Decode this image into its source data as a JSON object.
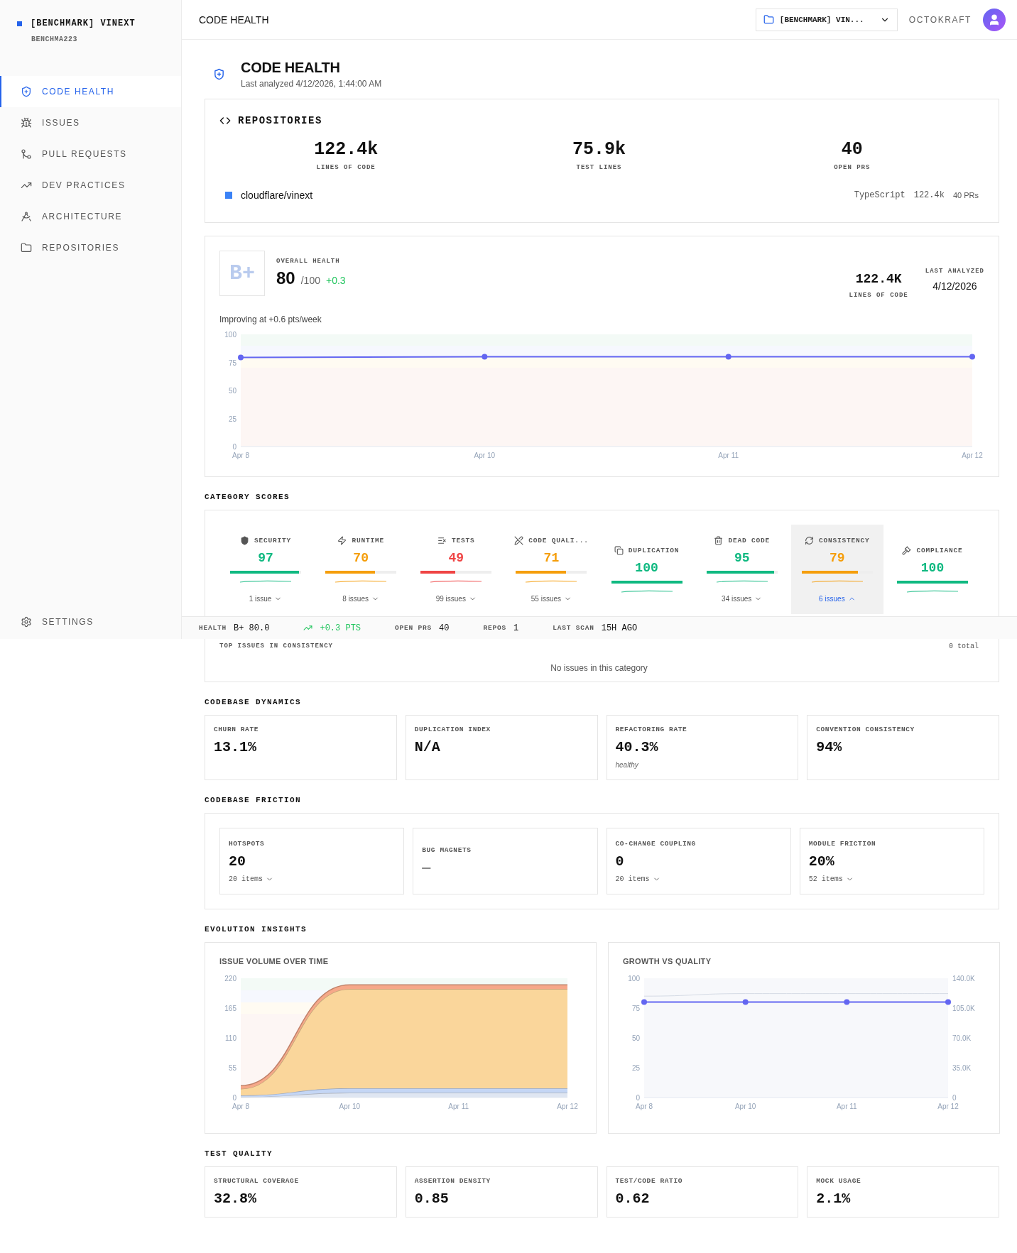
{
  "sidebar": {
    "workspace": "[BENCHMARK] VINEXT",
    "subtitle": "BENCHMA223",
    "items": [
      {
        "kind": "health",
        "label": "CODE HEALTH",
        "selected": true
      },
      {
        "kind": "issues",
        "label": "ISSUES",
        "selected": false
      },
      {
        "kind": "pulls",
        "label": "PULL REQUESTS",
        "selected": false
      },
      {
        "kind": "practices",
        "label": "DEV PRACTICES",
        "selected": false
      },
      {
        "kind": "architecture",
        "label": "ARCHITECTURE",
        "selected": false
      },
      {
        "kind": "repositories",
        "label": "REPOSITORIES",
        "selected": false
      }
    ],
    "settings": "SETTINGS"
  },
  "header": {
    "title": "CODE HEALTH",
    "repo_selector": "[BENCHMARK] VIN...",
    "org": "OCTOKRAFT"
  },
  "page": {
    "title": "CODE HEALTH",
    "subtitle": "Last analyzed 4/12/2026, 1:44:00 AM"
  },
  "repositories": {
    "title": "REPOSITORIES",
    "stats": [
      {
        "value": "122.4k",
        "label": "LINES OF CODE"
      },
      {
        "value": "75.9k",
        "label": "TEST LINES"
      },
      {
        "value": "40",
        "label": "OPEN PRS"
      }
    ],
    "repos": [
      {
        "name": "cloudflare/vinext",
        "color": "#3b82f6",
        "language": "TypeScript",
        "loc": "122.4k",
        "prs": "40 PRs"
      }
    ]
  },
  "health": {
    "grade": "B+",
    "label": "OVERALL HEALTH",
    "score": "80",
    "max": "/100",
    "delta": "+0.3",
    "loc_value": "122.4K",
    "loc_label": "LINES OF CODE",
    "analyzed_label": "LAST ANALYZED",
    "analyzed_value": "4/12/2026",
    "trend": "Improving at +0.6 pts/week",
    "chart_data": {
      "type": "line",
      "categories": [
        "Apr 8",
        "Apr 10",
        "Apr 11",
        "Apr 12"
      ],
      "series": [
        {
          "color": "#6366f1",
          "marker": "o",
          "values": [
            79.5,
            80,
            80,
            80
          ]
        }
      ],
      "ylim": [
        0,
        100
      ],
      "yticks": [
        0,
        25,
        50,
        75,
        100
      ]
    }
  },
  "category_scores": {
    "title": "CATEGORY SCORES",
    "items": [
      {
        "kind": "security",
        "name": "SECURITY",
        "score": "97",
        "level": 0.97,
        "color": "#10b981",
        "issues": "1 issue",
        "selected": false
      },
      {
        "kind": "runtime",
        "name": "RUNTIME",
        "score": "70",
        "level": 0.7,
        "color": "#f59e0b",
        "issues": "8 issues",
        "selected": false
      },
      {
        "kind": "tests",
        "name": "TESTS",
        "score": "49",
        "level": 0.49,
        "color": "#ef4444",
        "issues": "99 issues",
        "selected": false
      },
      {
        "kind": "quality",
        "name": "CODE QUALI...",
        "score": "71",
        "level": 0.71,
        "color": "#f59e0b",
        "issues": "55 issues",
        "selected": false
      },
      {
        "kind": "duplication",
        "name": "DUPLICATION",
        "score": "100",
        "level": 1,
        "color": "#10b981",
        "selected": false
      },
      {
        "kind": "dead",
        "name": "DEAD CODE",
        "score": "95",
        "level": 0.95,
        "color": "#10b981",
        "issues": "34 issues",
        "selected": false
      },
      {
        "kind": "consistency",
        "name": "CONSISTENCY",
        "score": "79",
        "level": 0.79,
        "color": "#f59e0b",
        "issues": "6 issues",
        "selected": true
      },
      {
        "kind": "compliance",
        "name": "COMPLIANCE",
        "score": "100",
        "level": 1,
        "color": "#10b981",
        "selected": false
      }
    ],
    "detail": {
      "title": "TOP ISSUES IN CONSISTENCY",
      "count": "0 total",
      "empty": "No issues in this category"
    }
  },
  "status_bar": [
    {
      "kind": "stat",
      "label": "HEALTH",
      "value": "B+ 80.0"
    },
    {
      "kind": "trend",
      "value": "+0.3 PTS"
    },
    {
      "kind": "stat",
      "label": "OPEN PRS",
      "value": "40"
    },
    {
      "kind": "stat",
      "label": "REPOS",
      "value": "1"
    },
    {
      "kind": "stat",
      "label": "LAST SCAN",
      "value": "15H AGO"
    }
  ],
  "dynamics": {
    "title": "CODEBASE DYNAMICS",
    "cards": [
      {
        "label": "CHURN RATE",
        "value": "13.1%"
      },
      {
        "label": "DUPLICATION INDEX",
        "value": "N/A"
      },
      {
        "label": "REFACTORING RATE",
        "value": "40.3%",
        "note": "healthy"
      },
      {
        "label": "CONVENTION CONSISTENCY",
        "value": "94%"
      }
    ]
  },
  "friction": {
    "title": "CODEBASE FRICTION",
    "cards": [
      {
        "label": "HOTSPOTS",
        "value": "20",
        "items": "20 items"
      },
      {
        "label": "BUG MAGNETS",
        "value": "—",
        "disabled": true
      },
      {
        "label": "CO-CHANGE COUPLING",
        "value": "0",
        "items": "20 items"
      },
      {
        "label": "MODULE FRICTION",
        "value": "20%",
        "items": "52 items"
      }
    ]
  },
  "evolution": {
    "title": "EVOLUTION INSIGHTS",
    "charts": [
      {
        "title": "ISSUE VOLUME OVER TIME",
        "chart_data": {
          "type": "area",
          "stacked": true,
          "categories": [
            "Apr 8",
            "Apr 10",
            "Apr 11",
            "Apr 12"
          ],
          "series": [
            {
              "color": "#dfe6f2",
              "values": [
                1,
                9,
                9,
                9
              ]
            },
            {
              "color": "#c4d6f5",
              "values": [
                3,
                8,
                8,
                8
              ]
            },
            {
              "color": "#fad69b",
              "values": [
                12,
                183,
                183,
                183
              ]
            },
            {
              "color": "#f6a889",
              "values": [
                6,
                8,
                8,
                8
              ]
            }
          ],
          "ylim": [
            0,
            220
          ],
          "yticks": [
            0,
            55,
            110,
            165,
            220
          ]
        }
      },
      {
        "title": "GROWTH VS QUALITY",
        "chart_data": {
          "type": "line",
          "categories": [
            "Apr 8",
            "Apr 10",
            "Apr 11",
            "Apr 12"
          ],
          "series": [
            {
              "color": "#6366f1",
              "marker": "o",
              "values": [
                80,
                80,
                80,
                80
              ]
            },
            {
              "color": "#d5dbe5",
              "axis": "y2",
              "values": [
                119000,
                122000,
                122000,
                122000
              ]
            }
          ],
          "ylim": [
            0,
            100
          ],
          "yticks": [
            0,
            25,
            50,
            75,
            100
          ],
          "y2lim": [
            0,
            140000
          ],
          "y2ticks": [
            {
              "value": 0,
              "label": "0"
            },
            {
              "value": 35000,
              "label": "35.0K"
            },
            {
              "value": 70000,
              "label": "70.0K"
            },
            {
              "value": 105000,
              "label": "105.0K"
            },
            {
              "value": 140000,
              "label": "140.0K"
            }
          ]
        }
      }
    ]
  },
  "test_quality": {
    "title": "TEST QUALITY",
    "cards": [
      {
        "label": "STRUCTURAL COVERAGE",
        "value": "32.8%"
      },
      {
        "label": "ASSERTION DENSITY",
        "value": "0.85"
      },
      {
        "label": "TEST/CODE RATIO",
        "value": "0.62"
      },
      {
        "label": "MOCK USAGE",
        "value": "2.1%"
      }
    ]
  }
}
